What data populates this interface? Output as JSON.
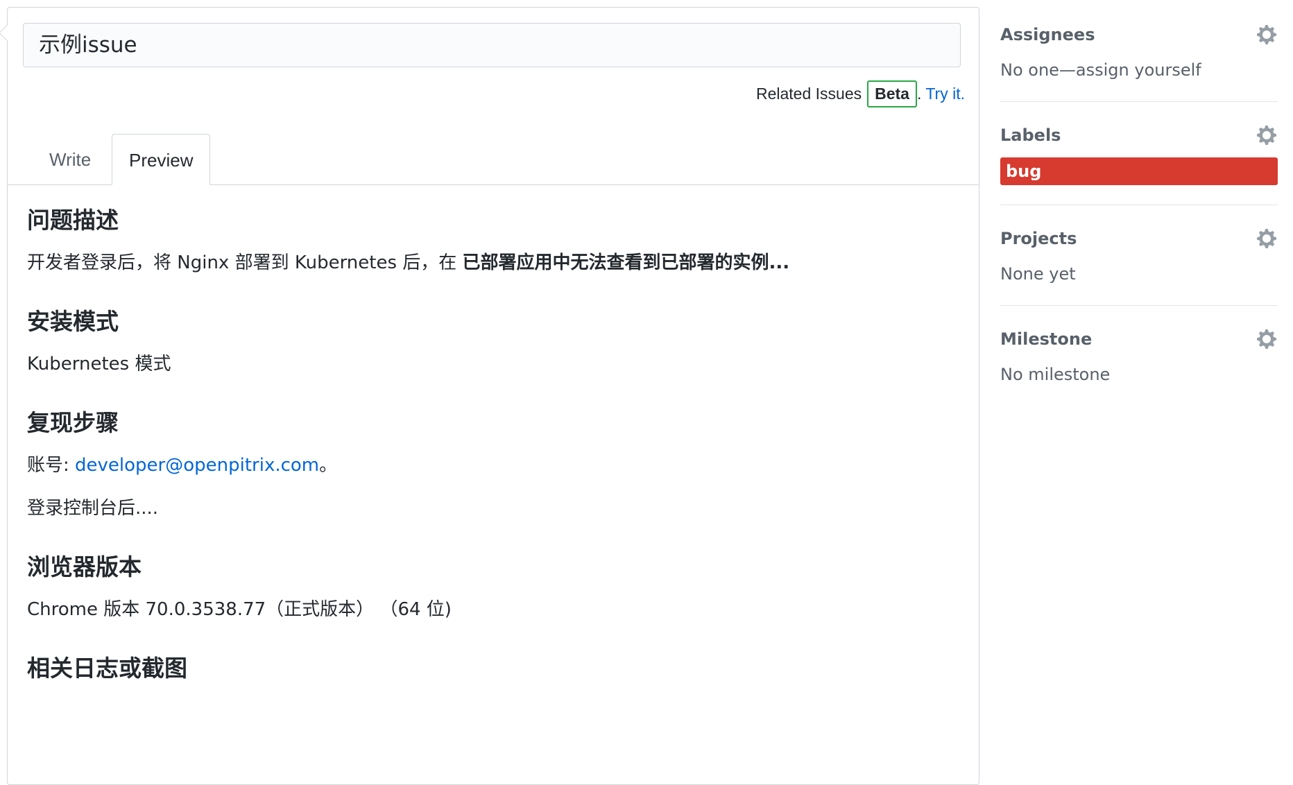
{
  "issue": {
    "title_value": "示例issue"
  },
  "related": {
    "text": "Related Issues",
    "badge": "Beta",
    "period": ".",
    "link": "Try it."
  },
  "tabs": [
    {
      "label": "Write",
      "active": false
    },
    {
      "label": "Preview",
      "active": true
    }
  ],
  "preview": {
    "sections": [
      {
        "heading": "问题描述"
      },
      {
        "heading": "安装模式"
      },
      {
        "heading": "复现步骤"
      },
      {
        "heading": "浏览器版本"
      },
      {
        "heading": "相关日志或截图"
      }
    ],
    "desc_plain": "开发者登录后，将 Nginx 部署到 Kubernetes 后，在 ",
    "desc_bold": "已部署应用中无法查看到已部署的实例...",
    "install_mode": "Kubernetes 模式",
    "account_prefix": "账号: ",
    "account_email": "developer@openpitrix.com",
    "account_suffix": "。",
    "after_login": "登录控制台后....",
    "browser": "Chrome 版本 70.0.3538.77（正式版本）  （64 位)"
  },
  "sidebar": {
    "assignees": {
      "heading": "Assignees",
      "value": "No one—assign yourself"
    },
    "labels": {
      "heading": "Labels",
      "items": [
        {
          "name": "bug",
          "color": "#d73a2f"
        }
      ]
    },
    "projects": {
      "heading": "Projects",
      "value": "None yet"
    },
    "milestone": {
      "heading": "Milestone",
      "value": "No milestone"
    }
  },
  "colors": {
    "link": "#0366d6",
    "beta_border": "#28a745",
    "bug_label": "#d73a2f"
  }
}
